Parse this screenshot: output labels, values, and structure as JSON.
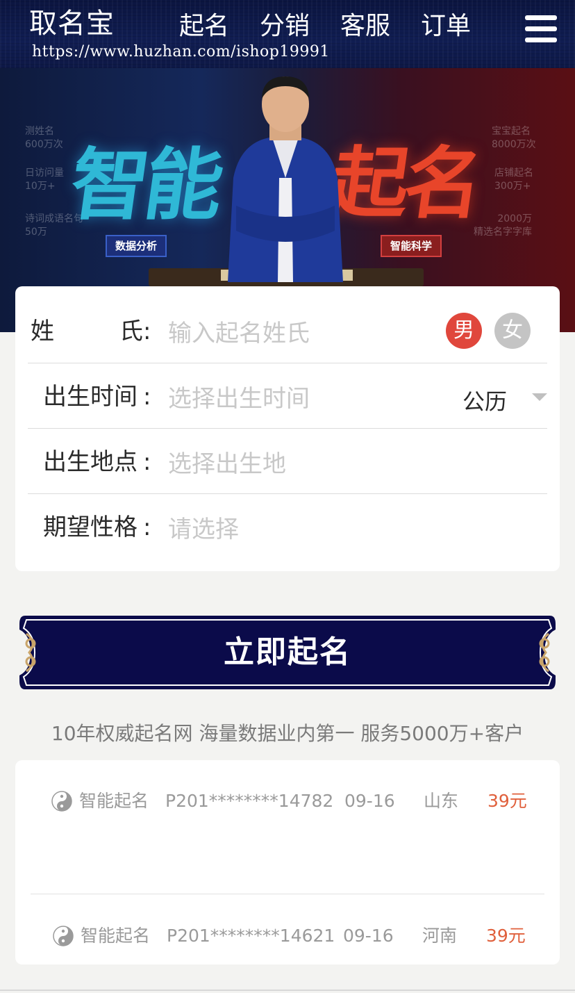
{
  "header": {
    "logo": "取名宝",
    "url": "https://www.huzhan.com/ishop19991",
    "nav": [
      "起名",
      "分销",
      "客服",
      "订单"
    ],
    "menu_icon": "hamburger-menu-icon"
  },
  "banner": {
    "headline_left": "智能",
    "headline_right": "起名",
    "tag_left": "数据分析",
    "tag_right": "智能科学",
    "stats_left": [
      "测姓名",
      "600万次",
      "日访问量",
      "10万+",
      "诗词成语名句",
      "50万"
    ],
    "stats_right": [
      "宝宝起名",
      "8000万次",
      "店铺起名",
      "300万+",
      "2000万",
      "精选名字字库"
    ]
  },
  "form": {
    "surname": {
      "label_a": "姓",
      "label_b": "氏",
      "colon": ":",
      "placeholder": "输入起名姓氏"
    },
    "gender": {
      "male": "男",
      "female": "女",
      "selected": "male"
    },
    "birth_time": {
      "label": "出生时间",
      "colon": ":",
      "placeholder": "选择出生时间",
      "calendar": "公历"
    },
    "birth_place": {
      "label": "出生地点",
      "colon": ":",
      "placeholder": "选择出生地"
    },
    "personality": {
      "label": "期望性格",
      "colon": ":",
      "placeholder": "请选择"
    }
  },
  "cta": {
    "label": "立即起名"
  },
  "slogan": "10年权威起名网 海量数据业内第一 服务5000万+客户",
  "orders": [
    {
      "service": "智能起名",
      "order_id": "P201********14782",
      "date": "09-16",
      "region": "山东",
      "price": "39元"
    },
    {
      "service": "智能起名",
      "order_id": "P201********14621",
      "date": "09-16",
      "region": "河南",
      "price": "39元"
    }
  ],
  "colors": {
    "header_bg": "#0d1846",
    "cta_bg": "#0b0b4a",
    "male_active": "#e0473c",
    "female_inactive": "#c4c4c4",
    "price": "#e0603c"
  }
}
